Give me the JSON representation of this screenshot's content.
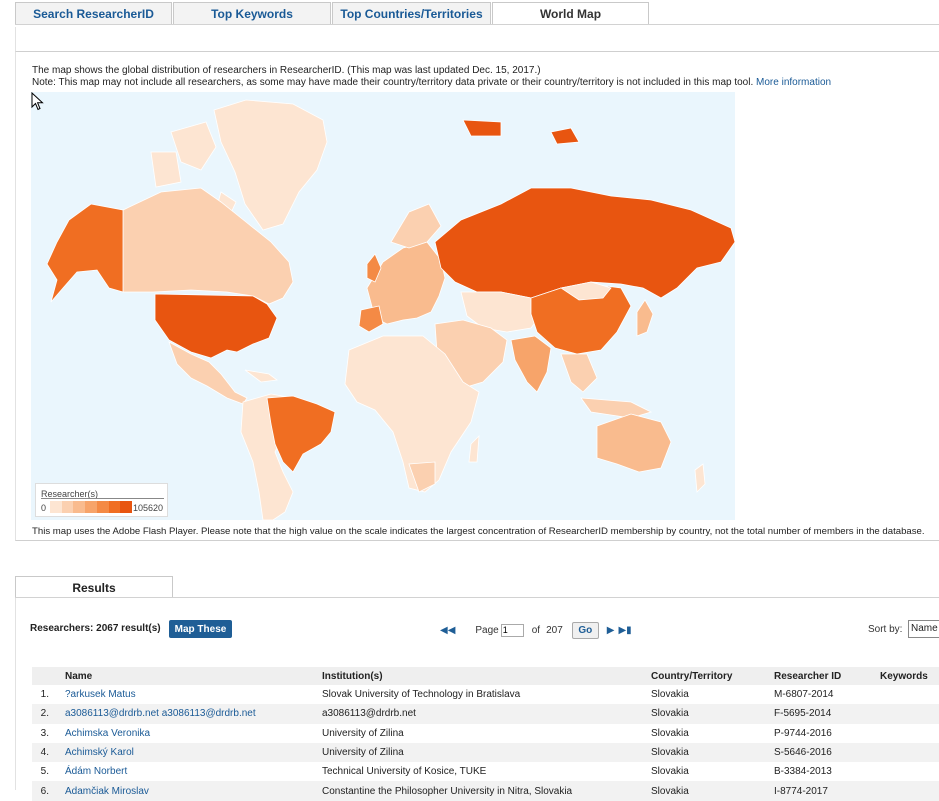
{
  "tabs": [
    "Search ResearcherID",
    "Top Keywords",
    "Top Countries/Territories",
    "World Map"
  ],
  "map_panel": {
    "intro_line1": "The map shows the global distribution of researchers in ResearcherID. (This map was last updated Dec. 15, 2017.)",
    "intro_line2": "Note: This map may not include all researchers, as some may have made their country/territory data private or their country/territory is not included in this map tool.",
    "more_info_link": "More information",
    "legend_title": "Researcher(s)",
    "legend_min": "0",
    "legend_max": "105620",
    "legend_colors": [
      "#fde5d2",
      "#fbd0b0",
      "#f9bb8e",
      "#f7a46a",
      "#f48a45",
      "#f06e22",
      "#e85510"
    ],
    "footnote": "This map uses the Adobe Flash Player. Please note that the high value on the scale indicates the largest concentration of ResearcherID membership by country, not the total number of members in the database."
  },
  "results": {
    "tab_label": "Results",
    "count_text": "Researchers: 2067 result(s)",
    "map_button": "Map These",
    "page_label": "Page",
    "page_value": "1",
    "of_label": "of",
    "total_pages": "207",
    "go_button": "Go",
    "sort_label": "Sort by:",
    "sort_value": "Name",
    "columns": [
      "Name",
      "Institution(s)",
      "Country/Territory",
      "Researcher ID",
      "Keywords"
    ],
    "rows": [
      {
        "n": "1.",
        "name": "?arkusek Matus",
        "inst": "Slovak University of Technology in Bratislava",
        "country": "Slovakia",
        "rid": "M-6807-2014"
      },
      {
        "n": "2.",
        "name": "a3086113@drdrb.net a3086113@drdrb.net",
        "inst": "a3086113@drdrb.net",
        "country": "Slovakia",
        "rid": "F-5695-2014"
      },
      {
        "n": "3.",
        "name": "Achimska Veronika",
        "inst": "University of Zilina",
        "country": "Slovakia",
        "rid": "P-9744-2016"
      },
      {
        "n": "4.",
        "name": "Achimský Karol",
        "inst": "University of Zilina",
        "country": "Slovakia",
        "rid": "S-5646-2016"
      },
      {
        "n": "5.",
        "name": "Ádám Norbert",
        "inst": "Technical University of Kosice, TUKE",
        "country": "Slovakia",
        "rid": "B-3384-2013"
      },
      {
        "n": "6.",
        "name": "Adamčiak Miroslav",
        "inst": "Constantine the Philosopher University in Nitra, Slovakia",
        "country": "Slovakia",
        "rid": "I-8774-2017"
      }
    ]
  }
}
